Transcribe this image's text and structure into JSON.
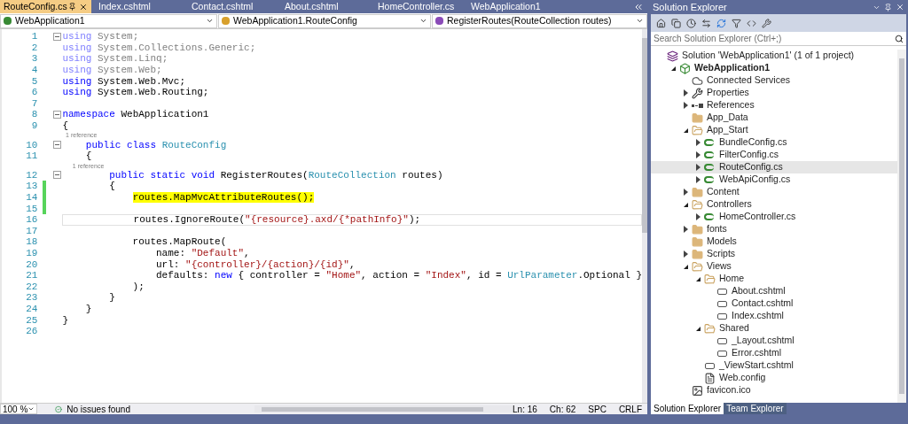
{
  "tabs": [
    {
      "label": "RouteConfig.cs",
      "selected": true
    },
    {
      "label": "Index.cshtml",
      "selected": false
    },
    {
      "label": "Contact.cshtml",
      "selected": false
    },
    {
      "label": "About.cshtml",
      "selected": false
    },
    {
      "label": "HomeController.cs",
      "selected": false
    },
    {
      "label": "WebApplication1",
      "selected": false
    }
  ],
  "nav_bar": {
    "project": "WebApplication1",
    "type": "WebApplication1.RouteConfig",
    "member": "RegisterRoutes(RouteCollection routes)"
  },
  "editor": {
    "lines": [
      {
        "number": "1",
        "fold": true,
        "changed": false,
        "current": false,
        "tokens": [
          {
            "kind": "faded_keyword",
            "text": "using"
          },
          {
            "kind": "faded",
            "text": " System;"
          }
        ]
      },
      {
        "number": "2",
        "fold": false,
        "changed": false,
        "current": false,
        "tokens": [
          {
            "kind": "faded_keyword",
            "text": "using"
          },
          {
            "kind": "faded",
            "text": " System.Collections.Generic;"
          }
        ]
      },
      {
        "number": "3",
        "fold": false,
        "changed": false,
        "current": false,
        "tokens": [
          {
            "kind": "faded_keyword",
            "text": "using"
          },
          {
            "kind": "faded",
            "text": " System.Linq;"
          }
        ]
      },
      {
        "number": "4",
        "fold": false,
        "changed": false,
        "current": false,
        "tokens": [
          {
            "kind": "faded_keyword",
            "text": "using"
          },
          {
            "kind": "faded",
            "text": " System.Web;"
          }
        ]
      },
      {
        "number": "5",
        "fold": false,
        "changed": false,
        "current": false,
        "tokens": [
          {
            "kind": "keyword",
            "text": "using"
          },
          {
            "kind": "plain",
            "text": " System.Web.Mvc;"
          }
        ]
      },
      {
        "number": "6",
        "fold": false,
        "changed": false,
        "current": false,
        "tokens": [
          {
            "kind": "keyword",
            "text": "using"
          },
          {
            "kind": "plain",
            "text": " System.Web.Routing;"
          }
        ]
      },
      {
        "number": "7",
        "fold": false,
        "changed": false,
        "current": false
      },
      {
        "number": "8",
        "fold": true,
        "changed": false,
        "current": false,
        "tokens": [
          {
            "kind": "keyword",
            "text": "namespace"
          },
          {
            "kind": "plain",
            "text": " WebApplication1"
          }
        ]
      },
      {
        "number": "9",
        "fold": false,
        "changed": false,
        "current": false,
        "tokens": [
          {
            "kind": "plain",
            "text": "{"
          }
        ]
      },
      {
        "number": "10",
        "fold": true,
        "changed": false,
        "current": false,
        "codelens": "1 reference",
        "tokens": [
          {
            "kind": "keyword",
            "text": "    public class"
          },
          {
            "kind": "type",
            "text": " RouteConfig"
          }
        ]
      },
      {
        "number": "11",
        "fold": false,
        "changed": false,
        "current": false,
        "tokens": [
          {
            "kind": "plain",
            "text": "    {"
          }
        ]
      },
      {
        "number": "12",
        "fold": true,
        "changed": false,
        "current": false,
        "codelens": "1 reference",
        "tokens": [
          {
            "kind": "keyword",
            "text": "        public static void"
          },
          {
            "kind": "plain",
            "text": " RegisterRoutes("
          },
          {
            "kind": "type",
            "text": "RouteCollection"
          },
          {
            "kind": "plain",
            "text": " routes)"
          }
        ]
      },
      {
        "number": "13",
        "fold": false,
        "changed": true,
        "current": false,
        "tokens": [
          {
            "kind": "plain",
            "text": "        {"
          }
        ]
      },
      {
        "number": "14",
        "fold": false,
        "changed": true,
        "current": false,
        "tokens": [
          {
            "kind": "highlight",
            "text": "            routes.MapMvcAttributeRoutes();"
          }
        ]
      },
      {
        "number": "15",
        "fold": false,
        "changed": true,
        "current": false
      },
      {
        "number": "16",
        "fold": false,
        "changed": false,
        "current": true,
        "tokens": [
          {
            "kind": "plain",
            "text": "            routes.IgnoreRoute("
          },
          {
            "kind": "string",
            "text": "\"{resource}.axd/{*pathInfo}\""
          },
          {
            "kind": "plain",
            "text": ");"
          }
        ]
      },
      {
        "number": "17",
        "fold": false,
        "changed": false,
        "current": false
      },
      {
        "number": "18",
        "fold": false,
        "changed": false,
        "current": false,
        "tokens": [
          {
            "kind": "plain",
            "text": "            routes.MapRoute("
          }
        ]
      },
      {
        "number": "19",
        "fold": false,
        "changed": false,
        "current": false,
        "tokens": [
          {
            "kind": "plain",
            "text": "                name: "
          },
          {
            "kind": "string",
            "text": "\"Default\""
          },
          {
            "kind": "plain",
            "text": ","
          }
        ]
      },
      {
        "number": "20",
        "fold": false,
        "changed": false,
        "current": false,
        "tokens": [
          {
            "kind": "plain",
            "text": "                url: "
          },
          {
            "kind": "string",
            "text": "\"{controller}/{action}/{id}\""
          },
          {
            "kind": "plain",
            "text": ","
          }
        ]
      },
      {
        "number": "21",
        "fold": false,
        "changed": false,
        "current": false,
        "tokens": [
          {
            "kind": "plain",
            "text": "                defaults: "
          },
          {
            "kind": "keyword",
            "text": "new"
          },
          {
            "kind": "plain",
            "text": " { controller = "
          },
          {
            "kind": "string",
            "text": "\"Home\""
          },
          {
            "kind": "plain",
            "text": ", action = "
          },
          {
            "kind": "string",
            "text": "\"Index\""
          },
          {
            "kind": "plain",
            "text": ", id = "
          },
          {
            "kind": "type",
            "text": "UrlParameter"
          },
          {
            "kind": "plain",
            "text": ".Optional }"
          }
        ]
      },
      {
        "number": "22",
        "fold": false,
        "changed": false,
        "current": false,
        "tokens": [
          {
            "kind": "plain",
            "text": "            );"
          }
        ]
      },
      {
        "number": "23",
        "fold": false,
        "changed": false,
        "current": false,
        "tokens": [
          {
            "kind": "plain",
            "text": "        }"
          }
        ]
      },
      {
        "number": "24",
        "fold": false,
        "changed": false,
        "current": false,
        "tokens": [
          {
            "kind": "plain",
            "text": "    }"
          }
        ]
      },
      {
        "number": "25",
        "fold": false,
        "changed": false,
        "current": false,
        "tokens": [
          {
            "kind": "plain",
            "text": "}"
          }
        ]
      },
      {
        "number": "26",
        "fold": false,
        "changed": false,
        "current": false
      }
    ]
  },
  "status_bar": {
    "zoom": "100 %",
    "issues": "No issues found",
    "line": "Ln: 16",
    "column": "Ch: 62",
    "indent": "SPC",
    "line_ending": "CRLF"
  },
  "solution_explorer": {
    "title": "Solution Explorer",
    "search": {
      "placeholder": "Search Solution Explorer (Ctrl+;)"
    },
    "tree": [
      {
        "label": "Solution 'WebApplication1' (1 of 1 project)",
        "kind": "solution",
        "expandable": false,
        "selected": false,
        "children": [
          {
            "label": "WebApplication1",
            "kind": "project",
            "expandable": true,
            "expanded": true,
            "selected": false,
            "children": [
              {
                "label": "Connected Services",
                "kind": "cloud",
                "expandable": false,
                "selected": false
              },
              {
                "label": "Properties",
                "kind": "wrench",
                "expandable": true,
                "expanded": false,
                "selected": false
              },
              {
                "label": "References",
                "kind": "references",
                "expandable": true,
                "expanded": false,
                "selected": false
              },
              {
                "label": "App_Data",
                "kind": "folder",
                "expandable": false,
                "selected": false
              },
              {
                "label": "App_Start",
                "kind": "folder",
                "expandable": true,
                "expanded": true,
                "selected": false,
                "children": [
                  {
                    "label": "BundleConfig.cs",
                    "kind": "csharp",
                    "expandable": true,
                    "expanded": false,
                    "selected": false
                  },
                  {
                    "label": "FilterConfig.cs",
                    "kind": "csharp",
                    "expandable": true,
                    "expanded": false,
                    "selected": false
                  },
                  {
                    "label": "RouteConfig.cs",
                    "kind": "csharp",
                    "expandable": true,
                    "expanded": false,
                    "selected": true
                  },
                  {
                    "label": "WebApiConfig.cs",
                    "kind": "csharp",
                    "expandable": true,
                    "expanded": false,
                    "selected": false
                  }
                ]
              },
              {
                "label": "Content",
                "kind": "folder",
                "expandable": true,
                "expanded": false,
                "selected": false
              },
              {
                "label": "Controllers",
                "kind": "folder",
                "expandable": true,
                "expanded": true,
                "selected": false,
                "children": [
                  {
                    "label": "HomeController.cs",
                    "kind": "csharp",
                    "expandable": true,
                    "expanded": false,
                    "selected": false
                  }
                ]
              },
              {
                "label": "fonts",
                "kind": "folder",
                "expandable": true,
                "expanded": false,
                "selected": false
              },
              {
                "label": "Models",
                "kind": "folder",
                "expandable": false,
                "selected": false
              },
              {
                "label": "Scripts",
                "kind": "folder",
                "expandable": true,
                "expanded": false,
                "selected": false
              },
              {
                "label": "Views",
                "kind": "folder",
                "expandable": true,
                "expanded": true,
                "selected": false,
                "children": [
                  {
                    "label": "Home",
                    "kind": "folder",
                    "expandable": true,
                    "expanded": true,
                    "selected": false,
                    "children": [
                      {
                        "label": "About.cshtml",
                        "kind": "razor",
                        "expandable": false,
                        "selected": false
                      },
                      {
                        "label": "Contact.cshtml",
                        "kind": "razor",
                        "expandable": false,
                        "selected": false
                      },
                      {
                        "label": "Index.cshtml",
                        "kind": "razor",
                        "expandable": false,
                        "selected": false
                      }
                    ]
                  },
                  {
                    "label": "Shared",
                    "kind": "folder",
                    "expandable": true,
                    "expanded": true,
                    "selected": false,
                    "children": [
                      {
                        "label": "_Layout.cshtml",
                        "kind": "razor",
                        "expandable": false,
                        "selected": false
                      },
                      {
                        "label": "Error.cshtml",
                        "kind": "razor",
                        "expandable": false,
                        "selected": false
                      }
                    ]
                  },
                  {
                    "label": "_ViewStart.cshtml",
                    "kind": "razor",
                    "expandable": false,
                    "selected": false
                  },
                  {
                    "label": "Web.config",
                    "kind": "config",
                    "expandable": false,
                    "selected": false
                  }
                ]
              },
              {
                "label": "favicon.ico",
                "kind": "image",
                "expandable": false,
                "selected": false
              }
            ]
          }
        ]
      }
    ],
    "bottom_tabs": [
      {
        "label": "Solution Explorer",
        "selected": true
      },
      {
        "label": "Team Explorer",
        "selected": false
      }
    ]
  }
}
